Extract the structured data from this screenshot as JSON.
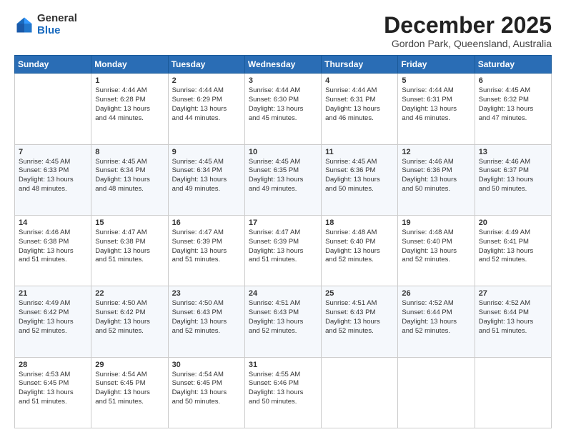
{
  "logo": {
    "general": "General",
    "blue": "Blue"
  },
  "title": "December 2025",
  "subtitle": "Gordon Park, Queensland, Australia",
  "days_header": [
    "Sunday",
    "Monday",
    "Tuesday",
    "Wednesday",
    "Thursday",
    "Friday",
    "Saturday"
  ],
  "weeks": [
    [
      {
        "day": "",
        "content": ""
      },
      {
        "day": "1",
        "content": "Sunrise: 4:44 AM\nSunset: 6:28 PM\nDaylight: 13 hours\nand 44 minutes."
      },
      {
        "day": "2",
        "content": "Sunrise: 4:44 AM\nSunset: 6:29 PM\nDaylight: 13 hours\nand 44 minutes."
      },
      {
        "day": "3",
        "content": "Sunrise: 4:44 AM\nSunset: 6:30 PM\nDaylight: 13 hours\nand 45 minutes."
      },
      {
        "day": "4",
        "content": "Sunrise: 4:44 AM\nSunset: 6:31 PM\nDaylight: 13 hours\nand 46 minutes."
      },
      {
        "day": "5",
        "content": "Sunrise: 4:44 AM\nSunset: 6:31 PM\nDaylight: 13 hours\nand 46 minutes."
      },
      {
        "day": "6",
        "content": "Sunrise: 4:45 AM\nSunset: 6:32 PM\nDaylight: 13 hours\nand 47 minutes."
      }
    ],
    [
      {
        "day": "7",
        "content": "Sunrise: 4:45 AM\nSunset: 6:33 PM\nDaylight: 13 hours\nand 48 minutes."
      },
      {
        "day": "8",
        "content": "Sunrise: 4:45 AM\nSunset: 6:34 PM\nDaylight: 13 hours\nand 48 minutes."
      },
      {
        "day": "9",
        "content": "Sunrise: 4:45 AM\nSunset: 6:34 PM\nDaylight: 13 hours\nand 49 minutes."
      },
      {
        "day": "10",
        "content": "Sunrise: 4:45 AM\nSunset: 6:35 PM\nDaylight: 13 hours\nand 49 minutes."
      },
      {
        "day": "11",
        "content": "Sunrise: 4:45 AM\nSunset: 6:36 PM\nDaylight: 13 hours\nand 50 minutes."
      },
      {
        "day": "12",
        "content": "Sunrise: 4:46 AM\nSunset: 6:36 PM\nDaylight: 13 hours\nand 50 minutes."
      },
      {
        "day": "13",
        "content": "Sunrise: 4:46 AM\nSunset: 6:37 PM\nDaylight: 13 hours\nand 50 minutes."
      }
    ],
    [
      {
        "day": "14",
        "content": "Sunrise: 4:46 AM\nSunset: 6:38 PM\nDaylight: 13 hours\nand 51 minutes."
      },
      {
        "day": "15",
        "content": "Sunrise: 4:47 AM\nSunset: 6:38 PM\nDaylight: 13 hours\nand 51 minutes."
      },
      {
        "day": "16",
        "content": "Sunrise: 4:47 AM\nSunset: 6:39 PM\nDaylight: 13 hours\nand 51 minutes."
      },
      {
        "day": "17",
        "content": "Sunrise: 4:47 AM\nSunset: 6:39 PM\nDaylight: 13 hours\nand 51 minutes."
      },
      {
        "day": "18",
        "content": "Sunrise: 4:48 AM\nSunset: 6:40 PM\nDaylight: 13 hours\nand 52 minutes."
      },
      {
        "day": "19",
        "content": "Sunrise: 4:48 AM\nSunset: 6:40 PM\nDaylight: 13 hours\nand 52 minutes."
      },
      {
        "day": "20",
        "content": "Sunrise: 4:49 AM\nSunset: 6:41 PM\nDaylight: 13 hours\nand 52 minutes."
      }
    ],
    [
      {
        "day": "21",
        "content": "Sunrise: 4:49 AM\nSunset: 6:42 PM\nDaylight: 13 hours\nand 52 minutes."
      },
      {
        "day": "22",
        "content": "Sunrise: 4:50 AM\nSunset: 6:42 PM\nDaylight: 13 hours\nand 52 minutes."
      },
      {
        "day": "23",
        "content": "Sunrise: 4:50 AM\nSunset: 6:43 PM\nDaylight: 13 hours\nand 52 minutes."
      },
      {
        "day": "24",
        "content": "Sunrise: 4:51 AM\nSunset: 6:43 PM\nDaylight: 13 hours\nand 52 minutes."
      },
      {
        "day": "25",
        "content": "Sunrise: 4:51 AM\nSunset: 6:43 PM\nDaylight: 13 hours\nand 52 minutes."
      },
      {
        "day": "26",
        "content": "Sunrise: 4:52 AM\nSunset: 6:44 PM\nDaylight: 13 hours\nand 52 minutes."
      },
      {
        "day": "27",
        "content": "Sunrise: 4:52 AM\nSunset: 6:44 PM\nDaylight: 13 hours\nand 51 minutes."
      }
    ],
    [
      {
        "day": "28",
        "content": "Sunrise: 4:53 AM\nSunset: 6:45 PM\nDaylight: 13 hours\nand 51 minutes."
      },
      {
        "day": "29",
        "content": "Sunrise: 4:54 AM\nSunset: 6:45 PM\nDaylight: 13 hours\nand 51 minutes."
      },
      {
        "day": "30",
        "content": "Sunrise: 4:54 AM\nSunset: 6:45 PM\nDaylight: 13 hours\nand 50 minutes."
      },
      {
        "day": "31",
        "content": "Sunrise: 4:55 AM\nSunset: 6:46 PM\nDaylight: 13 hours\nand 50 minutes."
      },
      {
        "day": "",
        "content": ""
      },
      {
        "day": "",
        "content": ""
      },
      {
        "day": "",
        "content": ""
      }
    ]
  ]
}
